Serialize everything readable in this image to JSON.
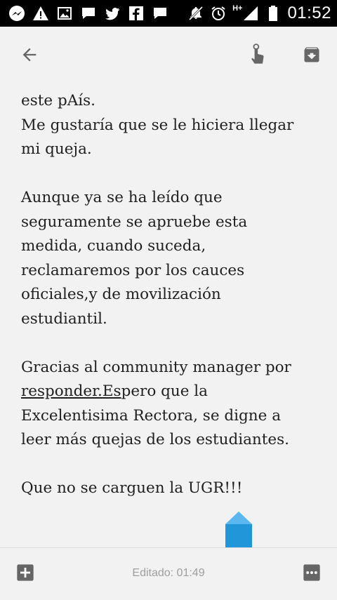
{
  "status_bar": {
    "time": "01:52",
    "network_type": "H+",
    "icons": [
      "messenger-icon",
      "alert-icon",
      "gallery-icon",
      "chat-bubble-icon",
      "twitter-icon",
      "facebook-icon",
      "chat-bubble-icon",
      "mute-icon",
      "alarm-icon",
      "signal-icon",
      "battery-icon"
    ]
  },
  "toolbar": {
    "back_icon": "arrow-back-icon",
    "touch_icon": "touch-gesture-icon",
    "archive_icon": "archive-icon"
  },
  "note": {
    "lines": [
      "este pAís.",
      "Me gustaría que se le hiciera llegar",
      "mi queja.",
      "",
      "Aunque ya se ha leído que",
      "seguramente se apruebe esta",
      "medida, cuando suceda,",
      "reclamaremos por los cauces",
      "oficiales,y de movilización",
      "estudiantil.",
      "",
      "Gracias al community manager por"
    ],
    "underlined_text": "responder.Es",
    "after_underline_text": "pero que la",
    "lines_after": [
      "Excelentisima Rectora, se digne a",
      "leer más quejas de los estudiantes.",
      "",
      "Que no se carguen la UGR!!!"
    ]
  },
  "bottom_bar": {
    "edited_label": "Editado: 01:49",
    "add_icon": "add-box-icon",
    "more_icon": "more-horizontal-icon"
  },
  "colors": {
    "background": "#f2f2f2",
    "text": "#1f1f1f",
    "icon_gray": "#666666",
    "handle_blue": "#2196d8"
  }
}
